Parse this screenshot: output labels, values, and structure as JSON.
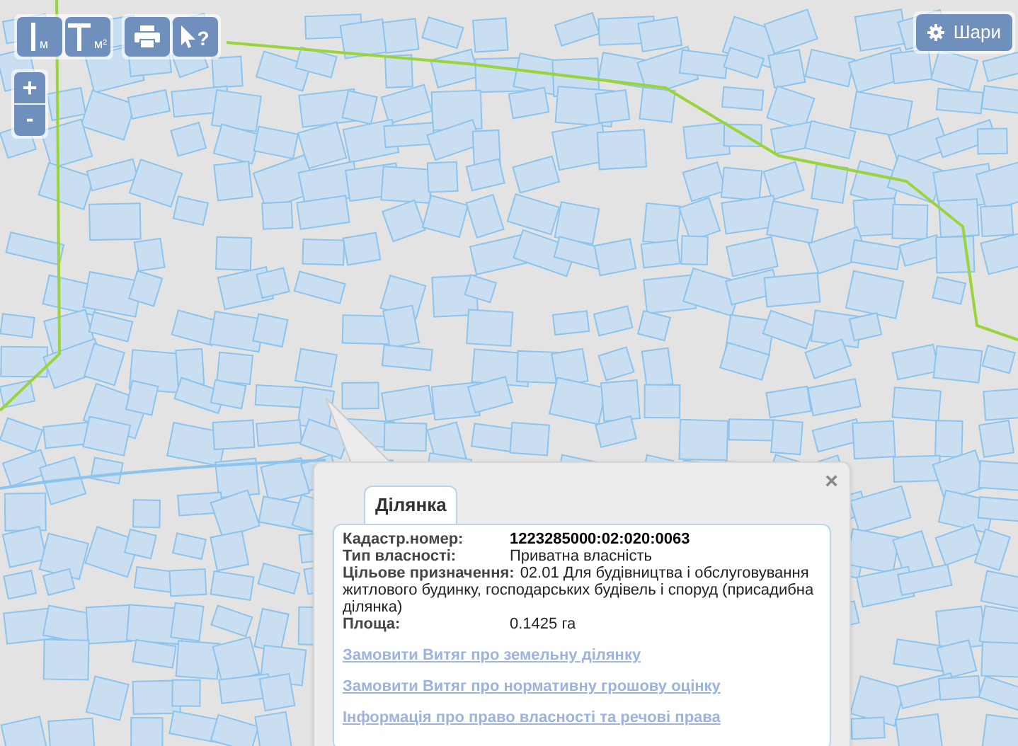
{
  "toolbar": [
    {
      "kind": "length",
      "label": "м"
    },
    {
      "kind": "area",
      "label": "м²"
    },
    {
      "kind": "print"
    },
    {
      "kind": "identify",
      "label": "?"
    }
  ],
  "zoom": {
    "in": "+",
    "out": "-"
  },
  "layers_button": {
    "label": "Шари"
  },
  "popup": {
    "close": "×",
    "tab": {
      "label": "Ділянка",
      "selected": true
    },
    "fields": [
      {
        "label": "Кадастр.номер:",
        "value": "1223285000:02:020:0063",
        "emphasis": true
      },
      {
        "label": "Тип власності:",
        "value": "Приватна власність",
        "emphasis": false
      },
      {
        "label": "Цільове призначення:",
        "value": "02.01 Для будівництва і обслуговування житлового будинку, господарських будівель і споруд (присадибна ділянка)",
        "emphasis": false
      },
      {
        "label": "Площа:",
        "value": "0.1425 га",
        "emphasis": false
      }
    ],
    "links": [
      "Замовити Витяг про земельну ділянку",
      "Замовити Витяг про нормативну грошову оцінку",
      "Інформація про право власності та речові права"
    ]
  }
}
